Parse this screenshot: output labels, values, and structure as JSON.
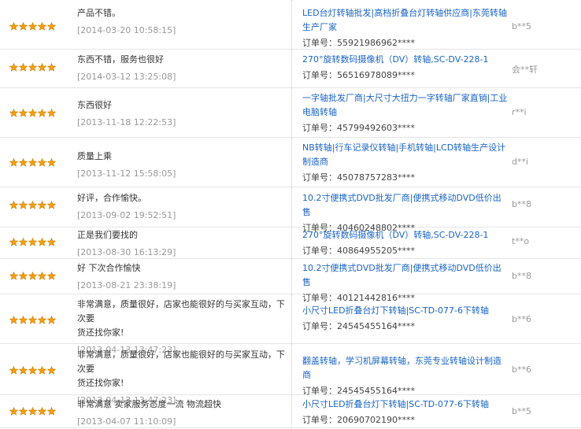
{
  "colors": {
    "link": "#1a64c8",
    "star_fill": "#f5a000",
    "star_stroke": "#c87800"
  },
  "labels": {
    "order_prefix": "订单号："
  },
  "reviews": [
    {
      "stars": 5,
      "comment": "产品不错。",
      "time": "[2014-03-20 10:58:15]",
      "product": "LED台灯转轴批发|高档折叠台灯转轴供应商|东莞转轴生产厂家",
      "order": "55921986962****",
      "buyer": "b**5"
    },
    {
      "stars": 5,
      "comment": "东西不错，服务也很好",
      "time": "[2014-03-12 13:25:08]",
      "product": "270°旋转数码摄像机（DV）转轴,SC-DV-228-1",
      "order": "56516978089****",
      "buyer": "会**轩"
    },
    {
      "stars": 5,
      "comment": "东西很好",
      "time": "[2013-11-18 12:22:53]",
      "product": "一字轴批发厂商|大尺寸大扭力一字转轴厂家直销|工业电脑转轴",
      "order": "45799492603****",
      "buyer": "r**i"
    },
    {
      "stars": 5,
      "comment": "质量上乘",
      "time": "[2013-11-12 15:58:05]",
      "product": "NB转轴|行车记录仪转轴|手机转轴|LCD转轴生产设计制造商",
      "order": "45078757283****",
      "buyer": "d**i"
    },
    {
      "stars": 5,
      "comment": "好评，合作愉快。",
      "time": "[2013-09-02 19:52:51]",
      "product": "10.2寸便携式DVD批发厂商|便携式移动DVD低价出售",
      "order": "40460248802****",
      "buyer": "b**8"
    },
    {
      "stars": 5,
      "comment": "正是我们要找的",
      "time": "[2013-08-30 16:13:29]",
      "product": "270°旋转数码摄像机（DV）转轴,SC-DV-228-1",
      "order": "40864955205****",
      "buyer": "t**o"
    },
    {
      "stars": 5,
      "comment": "好  下次合作愉快",
      "time": "[2013-08-21 23:38:19]",
      "product": "10.2寸便携式DVD批发厂商|便携式移动DVD低价出售",
      "order": "40121442816****",
      "buyer": "b**8"
    },
    {
      "stars": 5,
      "comment": "非常满意，质量很好，店家也能很好的与买家互动，下次要\n货还找你家!",
      "time": "[2013-04-13 13:47:23]",
      "product": "小尺寸LED折叠台灯下转轴|SC-TD-077-6下转轴",
      "order": "24545455164****",
      "buyer": "b**6"
    },
    {
      "stars": 5,
      "comment": "非常满意，质量很好，店家也能很好的与买家互动，下次要\n货还找你家!",
      "time": "[2013-04-13 13:47:23]",
      "product": "翻盖转轴，学习机屏幕转轴，东莞专业转轴设计制造商",
      "order": "24545455164****",
      "buyer": "b**6"
    },
    {
      "stars": 5,
      "comment": "非常满意  卖家服务态度一流  物流超快",
      "time": "[2013-04-07 11:10:09]",
      "product": "小尺寸LED折叠台灯下转轴|SC-TD-077-6下转轴",
      "order": "20690702190****",
      "buyer": "b**5"
    }
  ]
}
